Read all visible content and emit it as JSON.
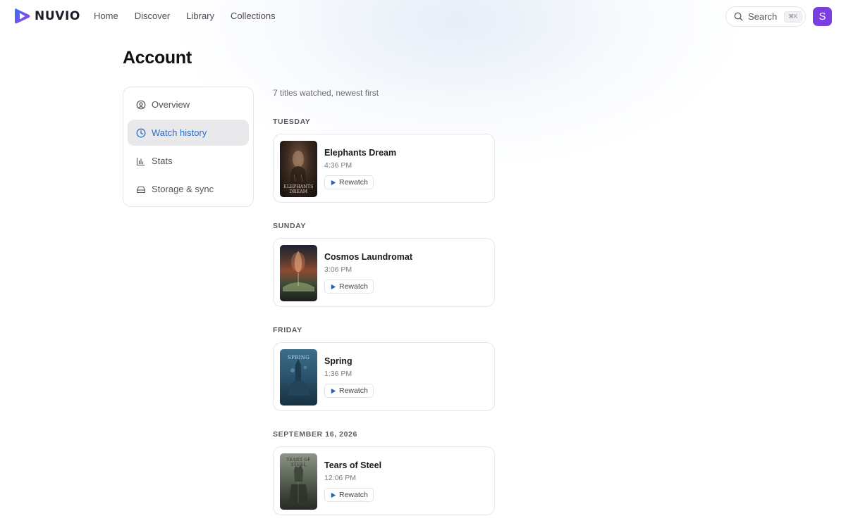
{
  "app": {
    "name": "NUVIO"
  },
  "nav": {
    "items": [
      "Home",
      "Discover",
      "Library",
      "Collections"
    ]
  },
  "search": {
    "label": "Search",
    "shortcut": "⌘K"
  },
  "user": {
    "initial": "S",
    "avatar_color": "#7b3fe0"
  },
  "page": {
    "title": "Account"
  },
  "sidebar": {
    "items": [
      {
        "label": "Overview",
        "icon": "user-circle-icon",
        "active": false
      },
      {
        "label": "Watch history",
        "icon": "clock-icon",
        "active": true
      },
      {
        "label": "Stats",
        "icon": "bar-chart-icon",
        "active": false
      },
      {
        "label": "Storage & sync",
        "icon": "hard-drive-icon",
        "active": false
      }
    ]
  },
  "history": {
    "summary": "7 titles watched, newest first",
    "groups": [
      {
        "day": "TUESDAY",
        "title": "Elephants Dream",
        "time": "4:36 PM",
        "action": "Rewatch",
        "poster_text": "ELEPHANTS DREAM"
      },
      {
        "day": "SUNDAY",
        "title": "Cosmos Laundromat",
        "time": "3:06 PM",
        "action": "Rewatch",
        "poster_text": ""
      },
      {
        "day": "FRIDAY",
        "title": "Spring",
        "time": "1:36 PM",
        "action": "Rewatch",
        "poster_text": "SPRING"
      },
      {
        "day": "SEPTEMBER 16, 2026",
        "title": "Tears of Steel",
        "time": "12:06 PM",
        "action": "Rewatch",
        "poster_text": "TEARS OF STEEL"
      }
    ]
  },
  "colors": {
    "accent": "#2d6fc9",
    "active_bg": "#e9e9ec",
    "play": "#2a5fb0"
  }
}
